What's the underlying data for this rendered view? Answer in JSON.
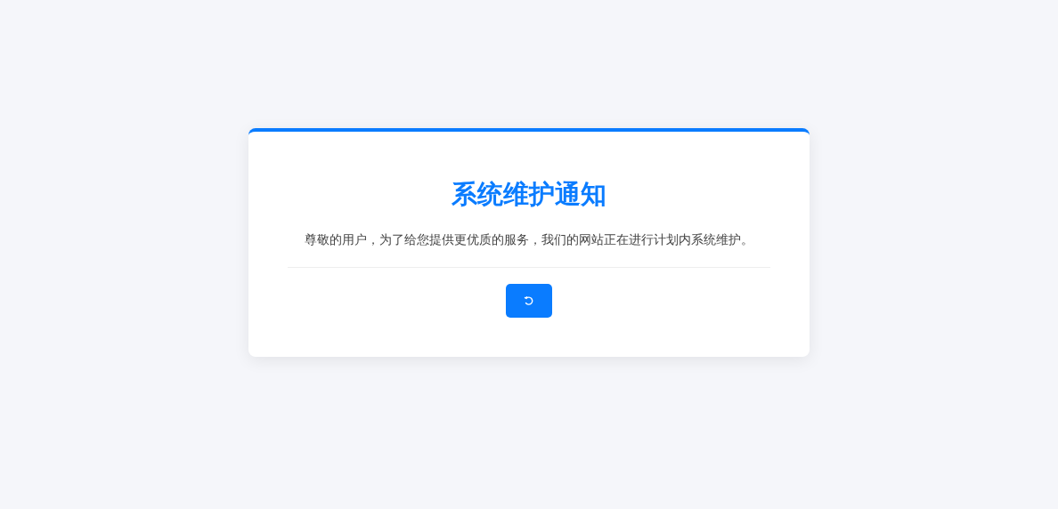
{
  "notice": {
    "title": "系统维护通知",
    "message": "尊敬的用户，为了给您提供更优质的服务，我们的网站正在进行计划内系统维护。"
  }
}
